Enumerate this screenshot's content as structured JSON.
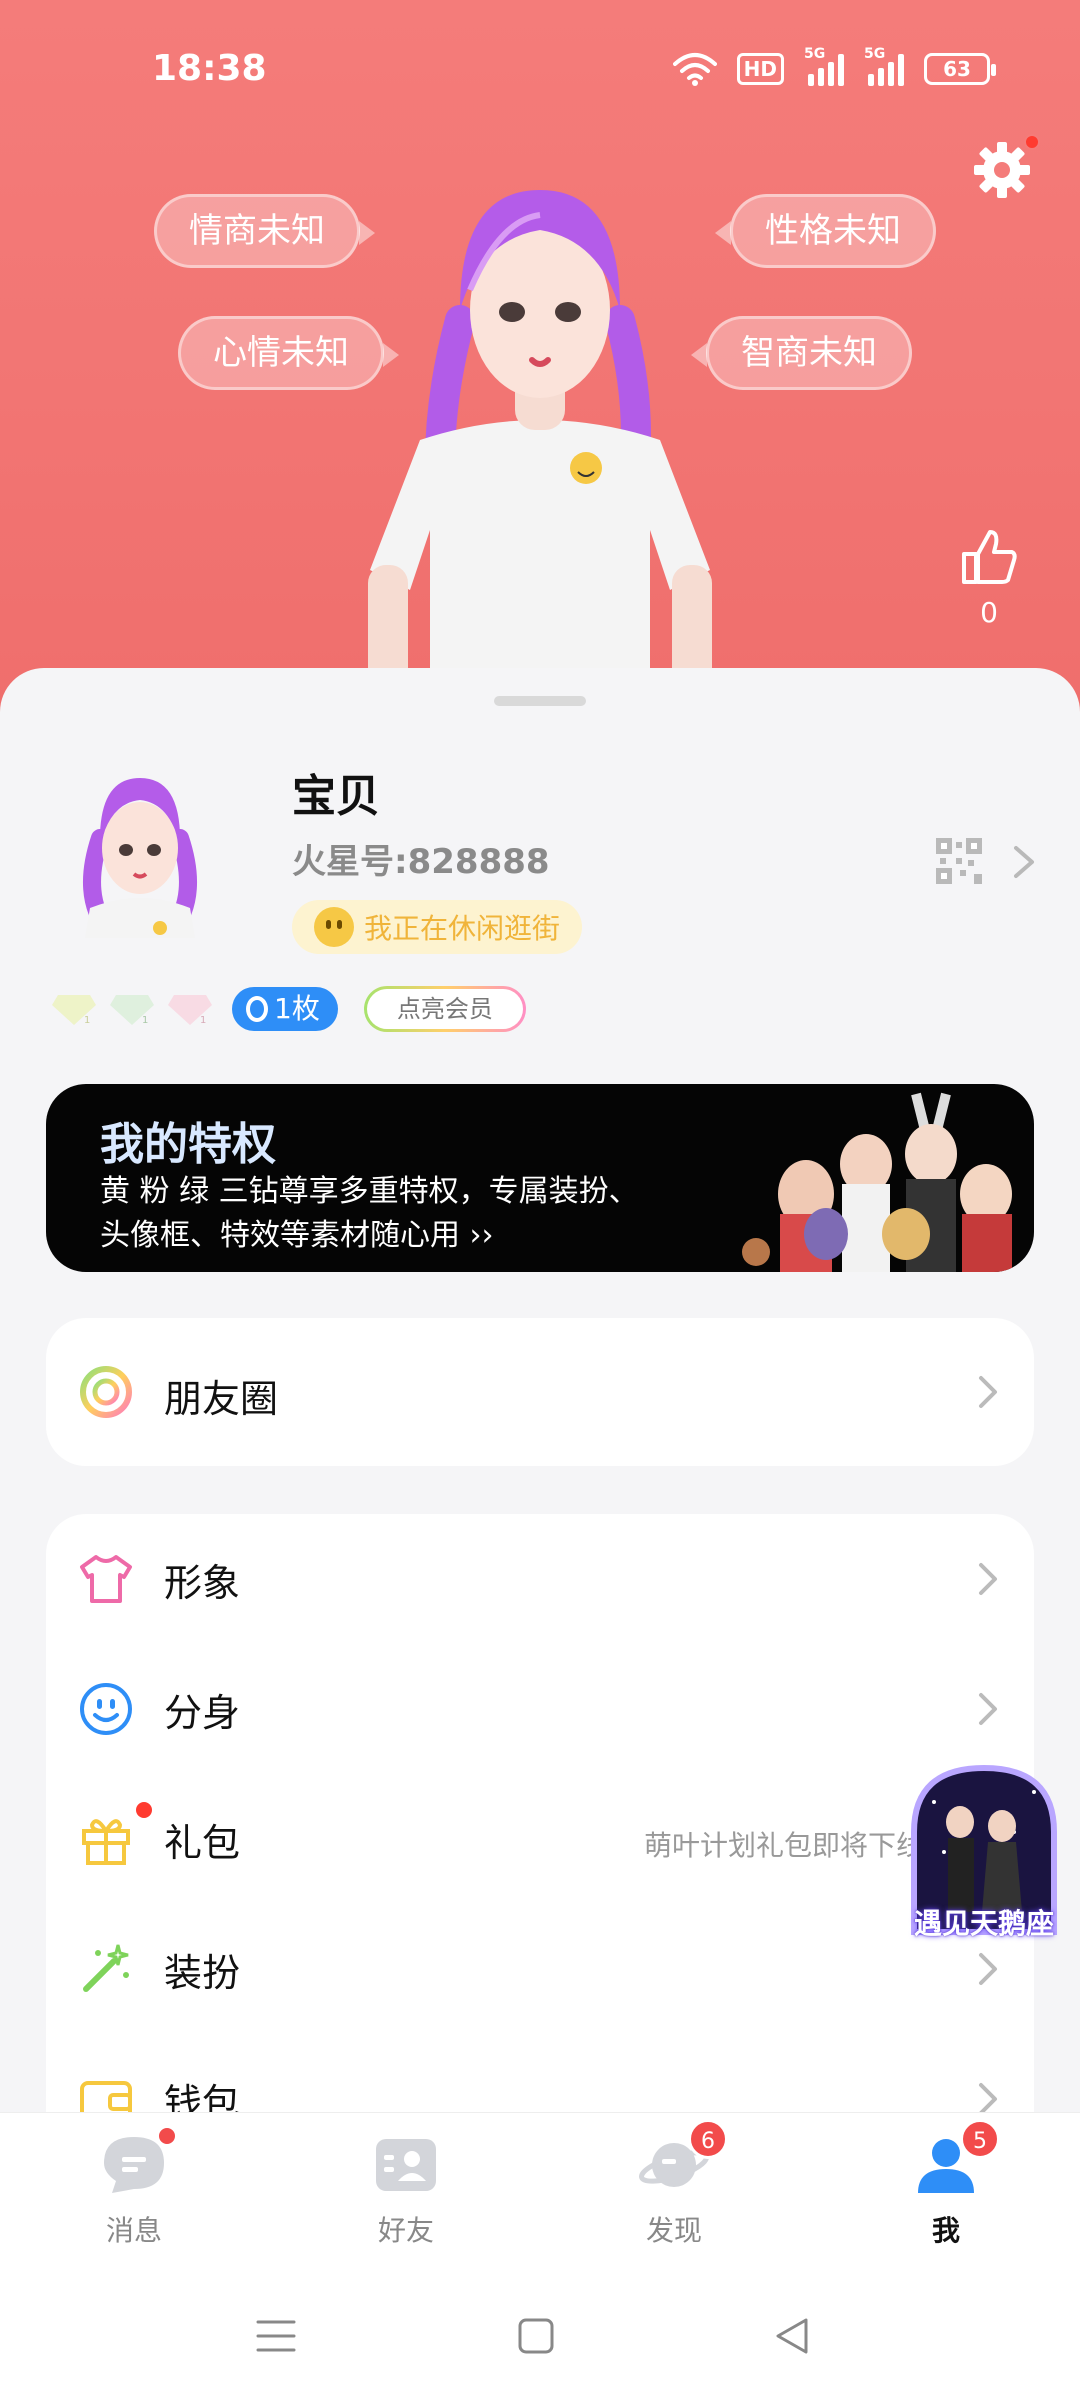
{
  "status": {
    "time": "18:38",
    "hd": "HD",
    "net1": "5G",
    "net2": "5G",
    "battery": "63"
  },
  "hero": {
    "bubbles": {
      "eq": "情商未知",
      "personality": "性格未知",
      "mood": "心情未知",
      "iq": "智商未知"
    },
    "likes": "0"
  },
  "profile": {
    "name": "宝贝",
    "uid_label": "火星号:",
    "uid_value": "828888",
    "mood_text": "我正在休闲逛街",
    "medal_count": "1枚",
    "vip_label": "点亮会员"
  },
  "privilege": {
    "title": "我的特权",
    "desc": "黄 粉 绿 三钻尊享多重特权，专属装扮、头像框、特效等素材随心用 ››"
  },
  "menu": {
    "moments": "朋友圈",
    "items": [
      {
        "label": "形象",
        "sub": ""
      },
      {
        "label": "分身",
        "sub": ""
      },
      {
        "label": "礼包",
        "sub": "萌叶计划礼包即将下线"
      },
      {
        "label": "装扮",
        "sub": ""
      },
      {
        "label": "钱包",
        "sub": ""
      }
    ]
  },
  "float_badge": {
    "text": "遇见天鹅座"
  },
  "nav": {
    "items": [
      {
        "label": "消息",
        "badge": ""
      },
      {
        "label": "好友",
        "badge": ""
      },
      {
        "label": "发现",
        "badge": "6"
      },
      {
        "label": "我",
        "badge": "5"
      }
    ]
  },
  "colors": {
    "hero": "#f47c7a",
    "accent_blue": "#2e8ef7",
    "badge_red": "#f24b4b"
  }
}
